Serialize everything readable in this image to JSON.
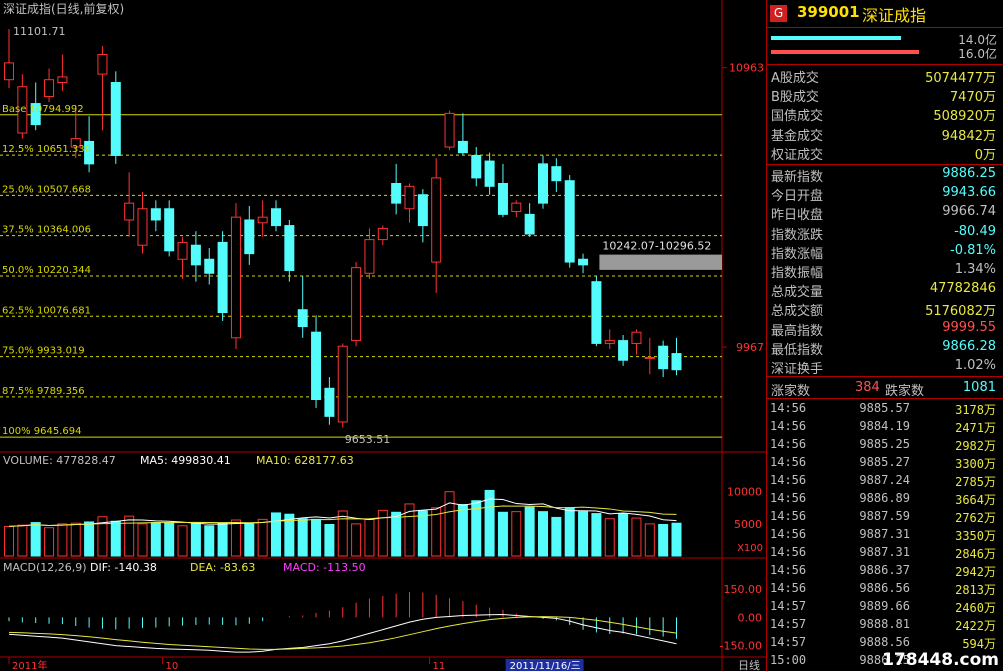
{
  "header": {
    "title": "深证成指(日线,前复权)",
    "code": "399001",
    "name": "深证成指",
    "g_label": "G"
  },
  "colors": {
    "up": "#ff3232",
    "down": "#54fcfc",
    "grid": "#b00000",
    "fib": "#d8d800",
    "text": "#c0c0c0"
  },
  "volume_bars": [
    {
      "value": "14.0亿",
      "color": "#54fcfc"
    },
    {
      "value": "16.0亿",
      "color": "#ff5050"
    }
  ],
  "summary": [
    {
      "label": "A股成交",
      "value": "5074477万",
      "color": "#e8e840"
    },
    {
      "label": "B股成交",
      "value": "7470万",
      "color": "#e8e840"
    },
    {
      "label": "国债成交",
      "value": "508920万",
      "color": "#e8e840"
    },
    {
      "label": "基金成交",
      "value": "94842万",
      "color": "#e8e840"
    },
    {
      "label": "权证成交",
      "value": "0万",
      "color": "#e8e840"
    }
  ],
  "quote": [
    {
      "label": "最新指数",
      "value": "9886.25",
      "color": "#54fcfc"
    },
    {
      "label": "今日开盘",
      "value": "9943.66",
      "color": "#54fcfc"
    },
    {
      "label": "昨日收盘",
      "value": "9966.74",
      "color": "#c0c0c0"
    },
    {
      "label": "指数涨跌",
      "value": "-80.49",
      "color": "#54fcfc"
    },
    {
      "label": "指数涨幅",
      "value": "-0.81%",
      "color": "#54fcfc"
    },
    {
      "label": "指数振幅",
      "value": "1.34%",
      "color": "#c0c0c0"
    },
    {
      "label": "总成交量",
      "value": "47782846",
      "color": "#e8e840"
    },
    {
      "label": "总成交额",
      "value": "5176082万",
      "color": "#e8e840"
    },
    {
      "label": "最高指数",
      "value": "9999.55",
      "color": "#ff5050"
    },
    {
      "label": "最低指数",
      "value": "9866.28",
      "color": "#54fcfc"
    },
    {
      "label": "深证换手",
      "value": "1.02%",
      "color": "#c0c0c0"
    }
  ],
  "breadth": {
    "up_label": "涨家数",
    "up_value": "384",
    "down_label": "跌家数",
    "down_value": "1081"
  },
  "ticks": [
    {
      "time": "14:56",
      "price": "9885.57",
      "vol": "3178万"
    },
    {
      "time": "14:56",
      "price": "9884.19",
      "vol": "2471万"
    },
    {
      "time": "14:56",
      "price": "9885.25",
      "vol": "2982万"
    },
    {
      "time": "14:56",
      "price": "9885.27",
      "vol": "3300万"
    },
    {
      "time": "14:56",
      "price": "9887.24",
      "vol": "2785万"
    },
    {
      "time": "14:56",
      "price": "9886.89",
      "vol": "3664万"
    },
    {
      "time": "14:56",
      "price": "9887.59",
      "vol": "2762万"
    },
    {
      "time": "14:56",
      "price": "9887.31",
      "vol": "3350万"
    },
    {
      "time": "14:56",
      "price": "9887.31",
      "vol": "2846万"
    },
    {
      "time": "14:56",
      "price": "9886.37",
      "vol": "2942万"
    },
    {
      "time": "14:56",
      "price": "9886.56",
      "vol": "2813万"
    },
    {
      "time": "14:57",
      "price": "9889.66",
      "vol": "2460万"
    },
    {
      "time": "14:57",
      "price": "9888.81",
      "vol": "2422万"
    },
    {
      "time": "14:57",
      "price": "9888.56",
      "vol": "594万"
    },
    {
      "time": "15:00",
      "price": "9886.25",
      "vol": ""
    }
  ],
  "watermark": "178448.com",
  "chart_data": [
    {
      "type": "candlestick",
      "title": "深证成指(日线,前复权)",
      "ylim": [
        9600,
        11140
      ],
      "y_ticks": [
        "10963",
        "9967"
      ],
      "y_tick_values": [
        10963,
        9967
      ],
      "x_ticks": [
        "2011年",
        "10",
        "11",
        "2011/11/16/三",
        "日线"
      ],
      "x_tick_index": [
        0,
        11.5,
        31.5,
        37.5,
        43
      ],
      "high_annotation": "11101.71",
      "low_annotation": "9653.51",
      "gap_label": "10242.07-10296.52",
      "gap_range": [
        10242.07,
        10296.52
      ],
      "fib_levels": [
        {
          "label": "Base 10794.992",
          "value": 10794.992
        },
        {
          "label": "12.5% 10651.330",
          "value": 10651.33
        },
        {
          "label": "25.0% 10507.668",
          "value": 10507.668
        },
        {
          "label": "37.5% 10364.006",
          "value": 10364.006
        },
        {
          "label": "50.0% 10220.344",
          "value": 10220.344
        },
        {
          "label": "62.5% 10076.681",
          "value": 10076.681
        },
        {
          "label": "75.0% 9933.019",
          "value": 9933.019
        },
        {
          "label": "87.5% 9789.356",
          "value": 9789.356
        },
        {
          "label": "100% 9645.694",
          "value": 9645.694
        }
      ],
      "candles": [
        [
          10920,
          10980,
          11101,
          10890
        ],
        [
          10730,
          10895,
          10940,
          10710
        ],
        [
          10835,
          10760,
          10910,
          10740
        ],
        [
          10860,
          10920,
          10960,
          10840
        ],
        [
          10910,
          10930,
          11010,
          10880
        ],
        [
          10680,
          10710,
          10830,
          10640
        ],
        [
          10700,
          10620,
          10790,
          10590
        ],
        [
          10940,
          11010,
          11040,
          10740
        ],
        [
          10910,
          10650,
          10950,
          10620
        ],
        [
          10420,
          10480,
          10590,
          10360
        ],
        [
          10330,
          10460,
          10520,
          10300
        ],
        [
          10460,
          10420,
          10490,
          10380
        ],
        [
          10460,
          10310,
          10490,
          10290
        ],
        [
          10280,
          10340,
          10360,
          10210
        ],
        [
          10330,
          10260,
          10380,
          10200
        ],
        [
          10280,
          10230,
          10320,
          10190
        ],
        [
          10340,
          10090,
          10380,
          10060
        ],
        [
          10000,
          10430,
          10480,
          9960
        ],
        [
          10420,
          10300,
          10470,
          10260
        ],
        [
          10410,
          10430,
          10490,
          10360
        ],
        [
          10460,
          10400,
          10490,
          10380
        ],
        [
          10400,
          10240,
          10420,
          10200
        ],
        [
          10100,
          10040,
          10220,
          10000
        ],
        [
          10020,
          9780,
          10080,
          9750
        ],
        [
          9820,
          9720,
          9860,
          9690
        ],
        [
          9700,
          9970,
          9980,
          9680
        ],
        [
          9990,
          10250,
          10270,
          9970
        ],
        [
          10230,
          10350,
          10390,
          10210
        ],
        [
          10350,
          10390,
          10400,
          10330
        ],
        [
          10550,
          10480,
          10620,
          10440
        ],
        [
          10460,
          10540,
          10550,
          10410
        ],
        [
          10510,
          10400,
          10530,
          10340
        ],
        [
          10270,
          10570,
          10640,
          10160
        ],
        [
          10680,
          10800,
          10810,
          10670
        ],
        [
          10700,
          10660,
          10800,
          10650
        ],
        [
          10650,
          10570,
          10680,
          10540
        ],
        [
          10630,
          10540,
          10660,
          10510
        ],
        [
          10550,
          10440,
          10620,
          10430
        ],
        [
          10450,
          10480,
          10490,
          10430
        ],
        [
          10440,
          10370,
          10480,
          10360
        ],
        [
          10620,
          10480,
          10650,
          10460
        ],
        [
          10610,
          10560,
          10640,
          10520
        ],
        [
          10560,
          10270,
          10580,
          10250
        ],
        [
          10280,
          10260,
          10300,
          10230
        ],
        [
          10200,
          9980,
          10220,
          9970
        ],
        [
          9980,
          9990,
          10030,
          9960
        ],
        [
          9990,
          9920,
          10010,
          9900
        ],
        [
          9980,
          10020,
          10030,
          9940
        ],
        [
          9930,
          9930,
          10000,
          9870
        ],
        [
          9970,
          9890,
          9990,
          9860
        ],
        [
          9943.66,
          9886.25,
          9999.55,
          9866.28
        ]
      ]
    },
    {
      "type": "bar",
      "title": "VOLUME",
      "legend": [
        {
          "name": "VOLUME",
          "value": "477828.47",
          "color": "#c0c0c0"
        },
        {
          "name": "MA5",
          "value": "499830.41",
          "color": "#ffffff"
        },
        {
          "name": "MA10",
          "value": "628177.63",
          "color": "#e8e840"
        }
      ],
      "y_ticks": [
        "10000",
        "5000"
      ],
      "y_tick_values": [
        10000,
        5000
      ],
      "unit": "X100",
      "ylim": [
        0,
        14000
      ],
      "values": [
        4600,
        4800,
        5200,
        4400,
        5000,
        5100,
        5300,
        6100,
        5400,
        6200,
        5000,
        5200,
        5200,
        4700,
        5200,
        4700,
        5100,
        5600,
        5000,
        5700,
        6700,
        6500,
        5800,
        5700,
        4900,
        7000,
        5000,
        5700,
        7100,
        6800,
        8100,
        7000,
        7500,
        10000,
        8000,
        8600,
        10200,
        6800,
        6900,
        7600,
        6900,
        6000,
        7500,
        6900,
        6600,
        5800,
        6600,
        5900,
        5000,
        4900,
        5100
      ],
      "ma5": [
        4600,
        4700,
        4870,
        4750,
        4800,
        4900,
        4960,
        5180,
        5380,
        5620,
        5600,
        5460,
        5400,
        5260,
        5100,
        4960,
        4960,
        5060,
        5120,
        5220,
        5420,
        5700,
        5940,
        6080,
        5920,
        6180,
        5880,
        5660,
        5940,
        6120,
        6940,
        7140,
        7300,
        8260,
        7900,
        8220,
        8860,
        8780,
        8160,
        8020,
        8100,
        7440,
        7040,
        7040,
        7000,
        6560,
        6680,
        6480,
        6220,
        5640,
        5500
      ],
      "ma10": [
        4600,
        4700,
        4870,
        4750,
        4800,
        4900,
        4960,
        5030,
        5060,
        5120,
        5160,
        5200,
        5190,
        5220,
        5240,
        5210,
        5190,
        5220,
        5180,
        5230,
        5400,
        5530,
        5580,
        5680,
        5650,
        5790,
        5780,
        5800,
        5950,
        6010,
        6140,
        6270,
        6450,
        6880,
        7190,
        7350,
        7620,
        7770,
        7750,
        7760,
        7700,
        7520,
        7520,
        7610,
        7460,
        7320,
        7000,
        6910,
        6780,
        6520,
        6470
      ]
    },
    {
      "type": "line",
      "title": "MACD(12,26,9)",
      "legend": [
        {
          "name": "DIF",
          "value": "-140.38",
          "color": "#ffffff"
        },
        {
          "name": "DEA",
          "value": "-83.63",
          "color": "#e8e840"
        },
        {
          "name": "MACD",
          "value": "-113.50",
          "color": "#ff40ff"
        }
      ],
      "y_ticks": [
        "150.00",
        "0.00",
        "-150.00"
      ],
      "y_tick_values": [
        150,
        0,
        -150
      ],
      "ylim": [
        -200,
        220
      ],
      "dif": [
        -90,
        -95,
        -100,
        -105,
        -110,
        -120,
        -130,
        -140,
        -150,
        -155,
        -160,
        -165,
        -168,
        -170,
        -172,
        -175,
        -180,
        -185,
        -185,
        -180,
        -170,
        -165,
        -160,
        -150,
        -140,
        -125,
        -105,
        -85,
        -65,
        -45,
        -25,
        -10,
        0,
        5,
        10,
        12,
        14,
        15,
        10,
        5,
        0,
        -5,
        -20,
        -40,
        -55,
        -70,
        -80,
        -95,
        -110,
        -125,
        -140.38
      ],
      "dea": [
        -80,
        -82,
        -85,
        -88,
        -92,
        -97,
        -103,
        -110,
        -118,
        -125,
        -132,
        -138,
        -144,
        -148,
        -152,
        -156,
        -160,
        -164,
        -168,
        -170,
        -170,
        -168,
        -165,
        -162,
        -158,
        -152,
        -144,
        -135,
        -122,
        -108,
        -92,
        -76,
        -60,
        -46,
        -33,
        -22,
        -12,
        -5,
        0,
        3,
        4,
        3,
        0,
        -7,
        -15,
        -26,
        -37,
        -50,
        -63,
        -74,
        -83.63
      ],
      "macd": [
        -20,
        -26,
        -30,
        -34,
        -36,
        -46,
        -54,
        -60,
        -64,
        -60,
        -56,
        -54,
        -48,
        -44,
        -40,
        -38,
        -40,
        -42,
        -34,
        -20,
        0,
        6,
        10,
        24,
        36,
        54,
        78,
        100,
        114,
        126,
        134,
        132,
        120,
        102,
        86,
        68,
        52,
        40,
        20,
        4,
        -8,
        -16,
        -40,
        -66,
        -80,
        -88,
        -86,
        -90,
        -94,
        -102,
        -113.5
      ]
    }
  ]
}
